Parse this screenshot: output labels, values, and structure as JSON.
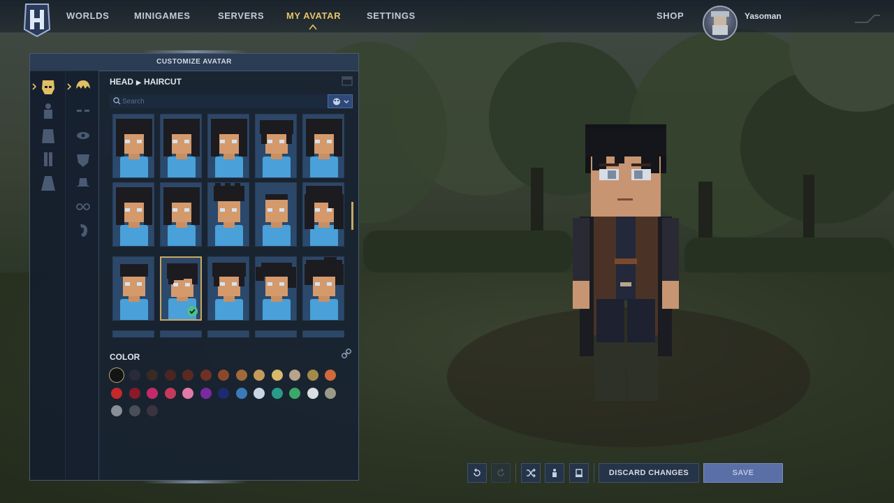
{
  "nav": {
    "items": [
      "WORLDS",
      "MINIGAMES",
      "SERVERS",
      "MY AVATAR",
      "SETTINGS"
    ],
    "active": "MY AVATAR",
    "shop": "SHOP",
    "username": "Yasoman"
  },
  "panel": {
    "title": "CUSTOMIZE AVATAR",
    "breadcrumb": {
      "category": "HEAD",
      "subcategory": "HAIRCUT"
    },
    "search_placeholder": "Search",
    "color_label": "COLOR",
    "selected_haircut_index": 11,
    "selected_color_index": 0
  },
  "colors": {
    "accent": "#c9a962",
    "panel_bg": "#182232",
    "save_button": "#5a6fa5",
    "swatches": [
      "#141414",
      "#2a2a38",
      "#3a2a24",
      "#4a2620",
      "#5a2a22",
      "#6e3224",
      "#8a4a2a",
      "#a06a3a",
      "#c69a5a",
      "#d8b86a",
      "#b8a48a",
      "#a48a4a",
      "#d06a3a",
      "#c42a2a",
      "#8a1a28",
      "#c42a6a",
      "#c43a5a",
      "#e07aa8",
      "#7a2aa0",
      "#1e2a6e",
      "#3a7ab8",
      "#c8d6e4",
      "#2a9a8a",
      "#3aa86a",
      "#d8dee4",
      "#9a9a86",
      "#8a8e96",
      "#4a4e58",
      "#3a3440"
    ]
  },
  "actions": {
    "discard": "DISCARD CHANGES",
    "save": "SAVE",
    "tools": [
      "undo-icon",
      "redo-icon",
      "shuffle-icon",
      "randomize-outfit-icon",
      "randomize-head-icon"
    ]
  },
  "haircuts": [
    {
      "style": "long"
    },
    {
      "style": "long"
    },
    {
      "style": "long"
    },
    {
      "style": "medium"
    },
    {
      "style": "long"
    },
    {
      "style": "long"
    },
    {
      "style": "long"
    },
    {
      "style": "short-spiky"
    },
    {
      "style": "bald-short"
    },
    {
      "style": "long-wavy"
    },
    {
      "style": "short"
    },
    {
      "style": "medium-fringe"
    },
    {
      "style": "medium"
    },
    {
      "style": "ponytail"
    },
    {
      "style": "curly"
    }
  ]
}
